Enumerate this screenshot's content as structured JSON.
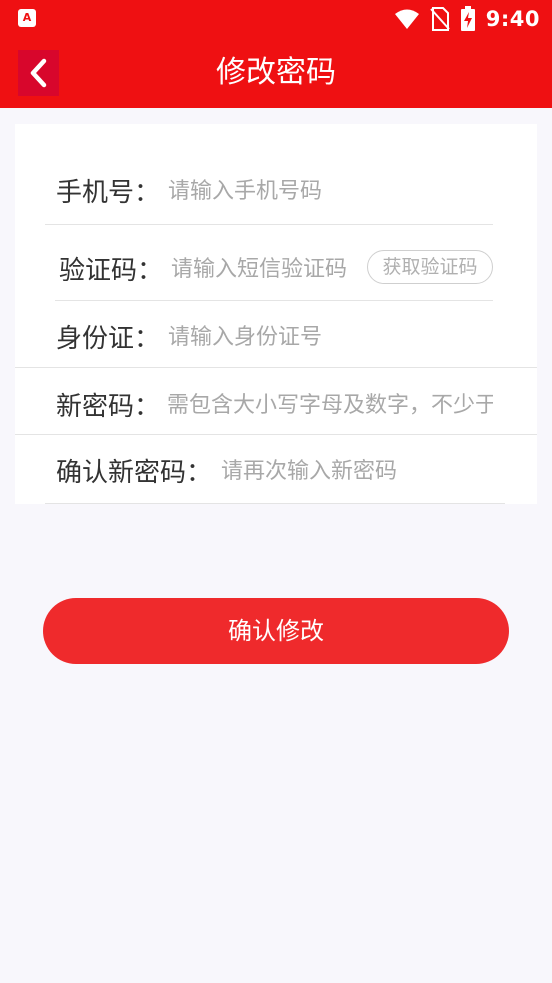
{
  "status_bar": {
    "app_badge": "A",
    "time": "9:40",
    "icons": [
      "wifi-icon",
      "no-sim-icon",
      "battery-charging-icon"
    ]
  },
  "header": {
    "title": "修改密码",
    "back_icon": "chevron-left-icon"
  },
  "form": {
    "phone": {
      "label": "手机号：",
      "placeholder": "请输入手机号码"
    },
    "code": {
      "label": "验证码：",
      "placeholder": "请输入短信验证码",
      "button": "获取验证码"
    },
    "id_card": {
      "label": "身份证：",
      "placeholder": "请输入身份证号"
    },
    "new_password": {
      "label": "新密码：",
      "placeholder": "需包含大小写字母及数字，不少于"
    },
    "confirm_password": {
      "label": "确认新密码：",
      "placeholder": "请再次输入新密码"
    }
  },
  "submit": {
    "label": "确认修改"
  },
  "colors": {
    "brand": "#ef1012",
    "button": "#ef2a2c",
    "background": "#f8f7fc"
  }
}
